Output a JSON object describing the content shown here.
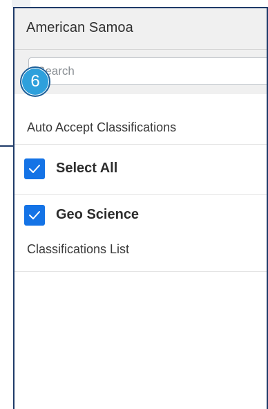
{
  "panel": {
    "title": "American Samoa"
  },
  "search": {
    "placeholder": "Search",
    "value": ""
  },
  "step_badge": {
    "number": "6",
    "color": "#2ea0dc"
  },
  "auto_accept": {
    "label": "Auto Accept Classifications"
  },
  "select_all": {
    "label": "Select All",
    "checked": true
  },
  "classifications": [
    {
      "label": "Geo Science",
      "checked": true
    }
  ],
  "classifications_list": {
    "label": "Classifications List"
  },
  "colors": {
    "accent": "#1473e6",
    "panel_border": "#1e3a68",
    "header_bg": "#f0f0f0"
  },
  "icons": {
    "checkbox": "check-icon"
  }
}
